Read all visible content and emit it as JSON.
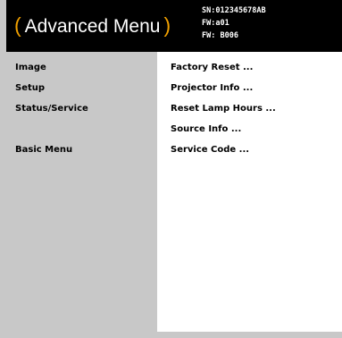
{
  "header": {
    "title": "Advanced Menu",
    "paren_open": "(",
    "paren_close": ")",
    "serial": "SN:012345678AB",
    "fw1": "FW:a01",
    "fw2": "FW: B006"
  },
  "left_menu": [
    {
      "label": "Image"
    },
    {
      "label": "Setup"
    },
    {
      "label": "Status/Service"
    },
    {
      "label": "Basic Menu"
    }
  ],
  "right_menu": [
    {
      "label": "Factory Reset ..."
    },
    {
      "label": "Projector Info ..."
    },
    {
      "label": "Reset Lamp Hours ..."
    },
    {
      "label": "Source Info ..."
    },
    {
      "label": "Service Code ..."
    }
  ]
}
